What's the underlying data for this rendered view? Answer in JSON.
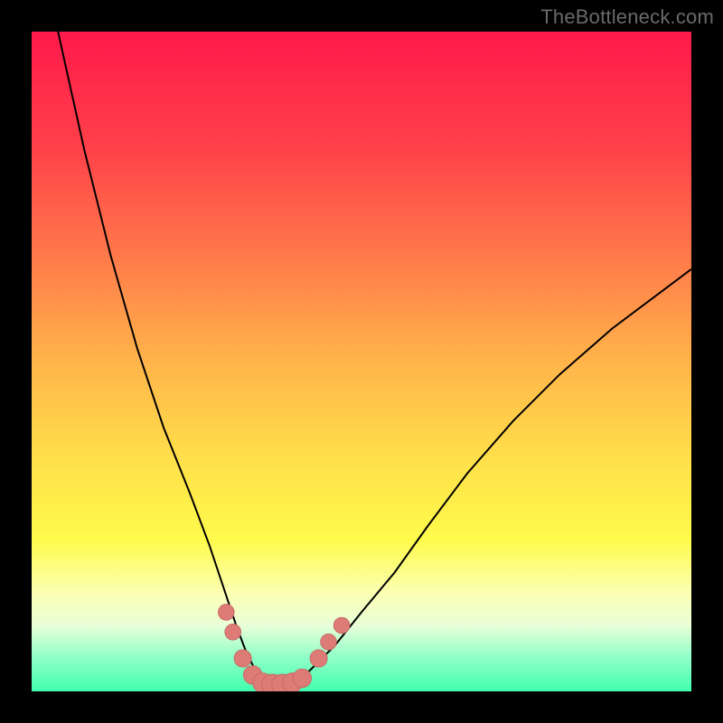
{
  "watermark": "TheBottleneck.com",
  "colors": {
    "background": "#000000",
    "curve_stroke": "#000000",
    "marker_fill": "#dd7b77",
    "marker_stroke": "#c96b66",
    "gradient_top": "#ff1a4b",
    "gradient_bottom": "#42ffad"
  },
  "chart_data": {
    "type": "line",
    "title": "",
    "xlabel": "",
    "ylabel": "",
    "xlim": [
      0,
      100
    ],
    "ylim": [
      0,
      100
    ],
    "grid": false,
    "series": [
      {
        "name": "curve",
        "x": [
          4,
          8,
          12,
          16,
          20,
          24,
          27,
          29,
          31,
          32.5,
          34,
          35.5,
          37,
          39,
          42,
          46,
          50,
          55,
          60,
          66,
          73,
          80,
          88,
          96,
          100
        ],
        "y": [
          100,
          82,
          66,
          52,
          40,
          30,
          22,
          16,
          10,
          6,
          3,
          1.5,
          1,
          1.5,
          3,
          7,
          12,
          18,
          25,
          33,
          41,
          48,
          55,
          61,
          64
        ]
      }
    ],
    "markers": [
      {
        "x": 29.5,
        "y": 12,
        "r": 1.2
      },
      {
        "x": 30.5,
        "y": 9,
        "r": 1.2
      },
      {
        "x": 32,
        "y": 5,
        "r": 1.3
      },
      {
        "x": 33.5,
        "y": 2.5,
        "r": 1.4
      },
      {
        "x": 35,
        "y": 1.3,
        "r": 1.5
      },
      {
        "x": 36.5,
        "y": 1,
        "r": 1.6
      },
      {
        "x": 38,
        "y": 1,
        "r": 1.6
      },
      {
        "x": 39.5,
        "y": 1.3,
        "r": 1.5
      },
      {
        "x": 41,
        "y": 2,
        "r": 1.4
      },
      {
        "x": 43.5,
        "y": 5,
        "r": 1.3
      },
      {
        "x": 45,
        "y": 7.5,
        "r": 1.2
      },
      {
        "x": 47,
        "y": 10,
        "r": 1.2
      }
    ]
  }
}
